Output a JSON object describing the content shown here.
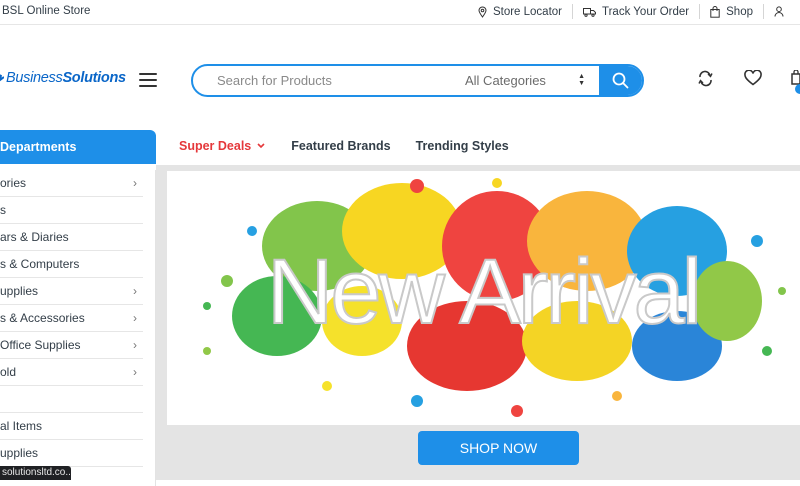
{
  "topbar": {
    "store_name": "BSL Online Store",
    "links": [
      {
        "label": "Store Locator",
        "icon": "map-pin-icon"
      },
      {
        "label": "Track Your Order",
        "icon": "truck-icon"
      },
      {
        "label": "Shop",
        "icon": "shopping-bag-icon"
      },
      {
        "label": "",
        "icon": "user-icon"
      }
    ]
  },
  "logo": {
    "bold": "Business",
    "rest": "Solutions"
  },
  "search": {
    "placeholder": "Search for Products",
    "category_selected": "All Categories",
    "search_icon": "search-icon"
  },
  "header_icons": [
    "compare-icon",
    "heart-icon",
    "cart-icon"
  ],
  "departments": {
    "title": "Departments",
    "items": [
      {
        "label": "ories",
        "has_submenu": true
      },
      {
        "label": "s",
        "has_submenu": false
      },
      {
        "label": "ars & Diaries",
        "has_submenu": false
      },
      {
        "label": "s & Computers",
        "has_submenu": false
      },
      {
        "label": "upplies",
        "has_submenu": true
      },
      {
        "label": "s & Accessories",
        "has_submenu": true
      },
      {
        "label": "Office Supplies",
        "has_submenu": true
      },
      {
        "label": "old",
        "has_submenu": true
      },
      {
        "label": "",
        "has_submenu": false
      },
      {
        "label": "al Items",
        "has_submenu": false
      },
      {
        "label": "upplies",
        "has_submenu": false
      }
    ]
  },
  "nav": {
    "tabs": [
      {
        "label": "Super Deals",
        "active": true,
        "dropdown": true
      },
      {
        "label": "Featured Brands",
        "active": false,
        "dropdown": false
      },
      {
        "label": "Trending Styles",
        "active": false,
        "dropdown": false
      }
    ]
  },
  "banner": {
    "headline": "New Arrival",
    "cta": "SHOP NOW"
  },
  "status_url": "solutionsltd.co...",
  "colors": {
    "accent": "#1e8fe8",
    "deal": "#e5383b",
    "text": "#333e48"
  }
}
